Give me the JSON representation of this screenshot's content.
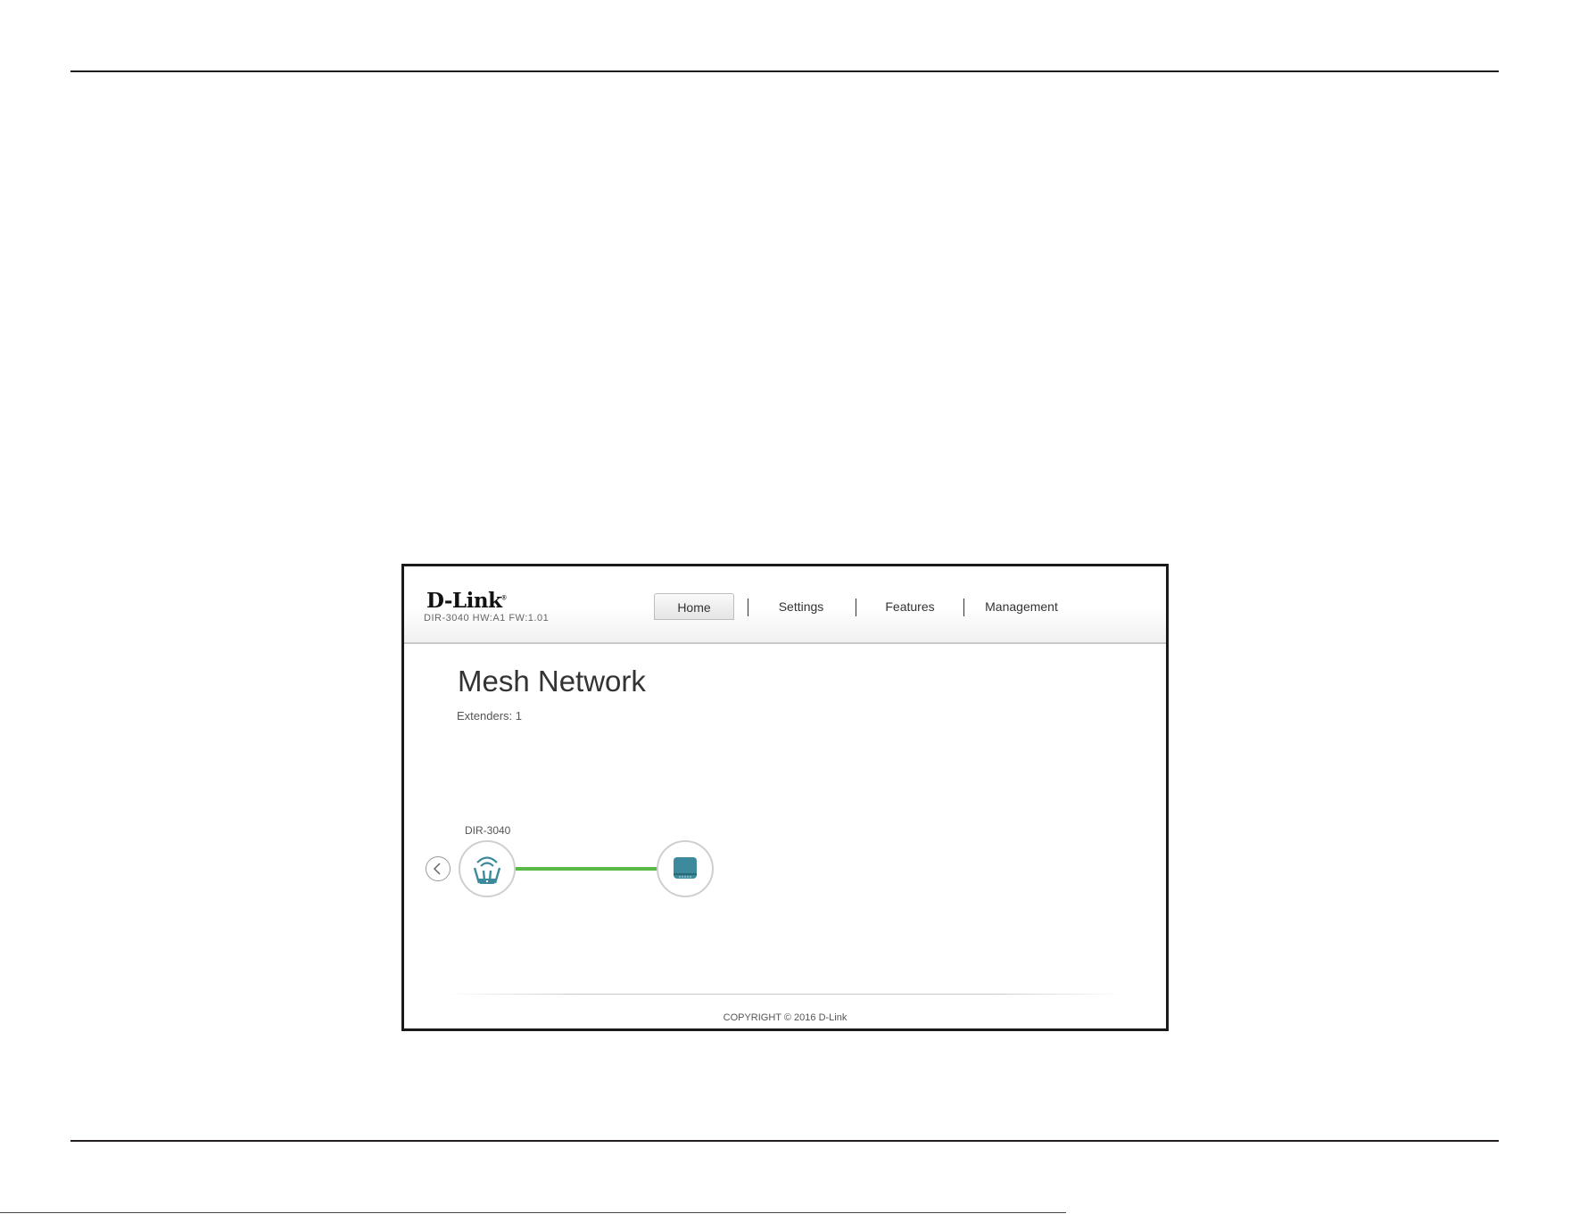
{
  "header": {
    "logo": "D-Link",
    "logo_mark": "®",
    "model_info": "DIR-3040 HW:A1 FW:1.01"
  },
  "nav": {
    "tabs": [
      {
        "label": "Home",
        "active": true
      },
      {
        "label": "Settings",
        "active": false
      },
      {
        "label": "Features",
        "active": false
      },
      {
        "label": "Management",
        "active": false
      }
    ]
  },
  "main": {
    "title": "Mesh Network",
    "extenders_label": "Extenders: 1"
  },
  "topology": {
    "router_label": "DIR-3040",
    "link_color": "#58b947",
    "router_icon": "router-icon",
    "extender_icon": "extender-icon",
    "icon_color": "#3d8a9c"
  },
  "footer": {
    "copyright": "COPYRIGHT © 2016 D-Link"
  }
}
